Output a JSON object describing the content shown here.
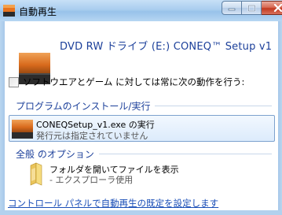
{
  "window": {
    "title": "自動再生",
    "title_icon": "autoplay-icon",
    "caption_buttons": [
      "minimize-icon",
      "maximize-icon",
      "close-icon"
    ]
  },
  "drive": {
    "title": "DVD RW ドライブ (E:) CONEQ™ Setup v1",
    "icon": "dvd-drive-icon"
  },
  "always_do": {
    "checked": false,
    "label": "ソフトウエアとゲーム に対しては常に次の動作を行う:"
  },
  "install_section": {
    "header": "プログラムのインストール/実行",
    "option": {
      "primary": "CONEQSetup_v1.exe の実行",
      "secondary": "発行元は指定されていません",
      "icon": "installer-icon",
      "selected": true
    }
  },
  "general_section": {
    "header": "全般 のオプション",
    "option": {
      "primary": "フォルダを開いてファイルを表示",
      "secondary": "- エクスプローラ使用",
      "icon": "folder-icon"
    }
  },
  "footer": {
    "link": "コントロール パネルで自動再生の既定を設定します"
  },
  "colors": {
    "accent_text": "#1b3f9a",
    "link": "#1b4fb8",
    "titlebar": "#a9cdef",
    "selection": "#dcebfc"
  }
}
